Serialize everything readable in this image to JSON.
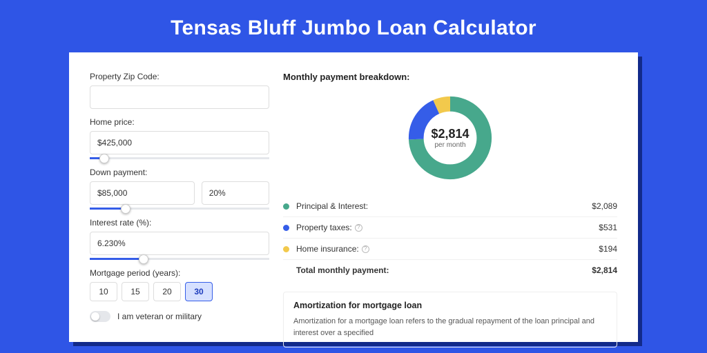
{
  "title": "Tensas Bluff Jumbo Loan Calculator",
  "colors": {
    "accent": "#355de8",
    "donut_pi": "#47a88c",
    "donut_tax": "#355de8",
    "donut_ins": "#f2c94c"
  },
  "form": {
    "zip": {
      "label": "Property Zip Code:",
      "value": ""
    },
    "home_price": {
      "label": "Home price:",
      "value": "$425,000",
      "slider_pct": 8
    },
    "down_payment": {
      "label": "Down payment:",
      "amount": "$85,000",
      "pct": "20%",
      "slider_pct": 20
    },
    "interest": {
      "label": "Interest rate (%):",
      "value": "6.230%",
      "slider_pct": 30
    },
    "mortgage_period": {
      "label": "Mortgage period (years):",
      "options": [
        "10",
        "15",
        "20",
        "30"
      ],
      "active": "30"
    },
    "veteran": {
      "label": "I am veteran or military",
      "on": false
    }
  },
  "breakdown": {
    "title": "Monthly payment breakdown:",
    "center_value": "$2,814",
    "center_sub": "per month",
    "items": [
      {
        "key": "pi",
        "label": "Principal & Interest:",
        "value": "$2,089",
        "amount": 2089,
        "color": "#47a88c",
        "info": false
      },
      {
        "key": "tax",
        "label": "Property taxes:",
        "value": "$531",
        "amount": 531,
        "color": "#355de8",
        "info": true
      },
      {
        "key": "ins",
        "label": "Home insurance:",
        "value": "$194",
        "amount": 194,
        "color": "#f2c94c",
        "info": true
      }
    ],
    "total": {
      "label": "Total monthly payment:",
      "value": "$2,814",
      "amount": 2814
    }
  },
  "amortization": {
    "title": "Amortization for mortgage loan",
    "text": "Amortization for a mortgage loan refers to the gradual repayment of the loan principal and interest over a specified"
  },
  "chart_data": {
    "type": "pie",
    "title": "Monthly payment breakdown",
    "series": [
      {
        "name": "Principal & Interest",
        "value": 2089,
        "color": "#47a88c"
      },
      {
        "name": "Property taxes",
        "value": 531,
        "color": "#355de8"
      },
      {
        "name": "Home insurance",
        "value": 194,
        "color": "#f2c94c"
      }
    ],
    "center_label": "$2,814 per month",
    "total": 2814
  }
}
